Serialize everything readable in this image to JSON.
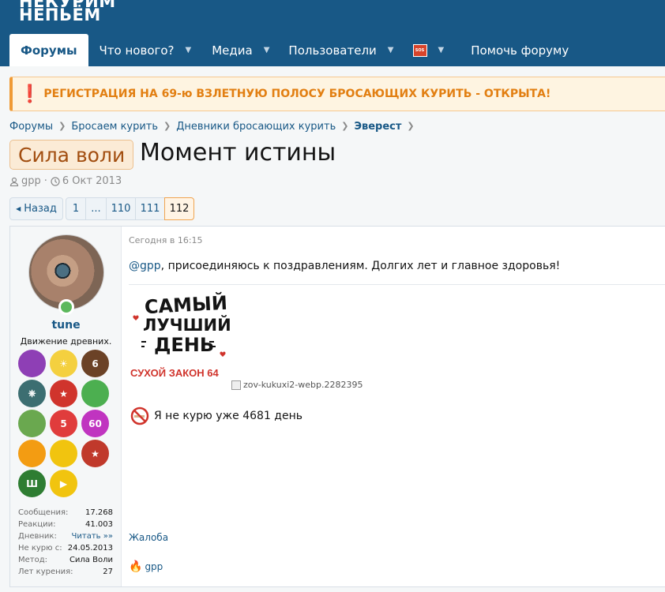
{
  "logo": {
    "line1": "НЕКУРИМ",
    "line2": "НЕПЬЁМ"
  },
  "nav": {
    "forums": "Форумы",
    "whats_new": "Что нового?",
    "media": "Медиа",
    "members": "Пользователи",
    "sos_label": "SOS",
    "help": "Помочь форуму"
  },
  "notice": {
    "icon": "❗",
    "text": "РЕГИСТРАЦИЯ НА 69-ю ВЗЛЕТНУЮ ПОЛОСУ БРОСАЮЩИХ КУРИТЬ - ОТКРЫТА!"
  },
  "breadcrumb": [
    "Форумы",
    "Бросаем курить",
    "Дневники бросающих курить",
    "Эверест"
  ],
  "thread": {
    "prefix": "Сила воли",
    "title": "Момент истины",
    "author": "gpp",
    "date": "6 Окт 2013"
  },
  "pager": {
    "back": "Назад",
    "pages": [
      "1",
      "...",
      "110",
      "111",
      "112"
    ],
    "current": "112"
  },
  "post": {
    "user": {
      "name": "tune",
      "title": "Движение древних.",
      "stats": [
        {
          "k": "Сообщения:",
          "v": "17.268"
        },
        {
          "k": "Реакции:",
          "v": "41.003"
        },
        {
          "k": "Дневник:",
          "v": "Читать »»"
        },
        {
          "k": "Не курю с:",
          "v": "24.05.2013"
        },
        {
          "k": "Метод:",
          "v": "Сила Воли"
        },
        {
          "k": "Лет курения:",
          "v": "27"
        }
      ],
      "badges": [
        {
          "color": "#8e3fb5",
          "text": ""
        },
        {
          "color": "#f4d03f",
          "text": "☀"
        },
        {
          "color": "#6b4226",
          "text": "6"
        },
        {
          "color": "#3c6e71",
          "text": "⎈"
        },
        {
          "color": "#d0342c",
          "text": "★"
        },
        {
          "color": "#4caf50",
          "text": ""
        },
        {
          "color": "#6aa84f",
          "text": ""
        },
        {
          "color": "#e03c3c",
          "text": "5"
        },
        {
          "color": "#c034c0",
          "text": "60"
        },
        {
          "color": "#f39c12",
          "text": ""
        },
        {
          "color": "#f1c40f",
          "text": ""
        },
        {
          "color": "#c0392b",
          "text": "★"
        },
        {
          "color": "#2e7d32",
          "text": "Ш"
        },
        {
          "color": "#f1c40f",
          "text": "▶"
        }
      ]
    },
    "time": "Сегодня в 16:15",
    "mention": "@gpp",
    "message": ", присоединяюсь к поздравлениям. Долгих лет и главное здоровья!",
    "sticker_lines": [
      "САМЫЙ",
      "ЛУЧШИЙ",
      "ДЕНЬ"
    ],
    "sticker_caption": "СУХОЙ ЗАКОН 64",
    "broken_image_alt": "zov-kukuxi2-webp.2282395",
    "no_smoke_text": "Я не курю уже 4681 день",
    "report": "Жалоба",
    "reaction_user": "gpp"
  }
}
